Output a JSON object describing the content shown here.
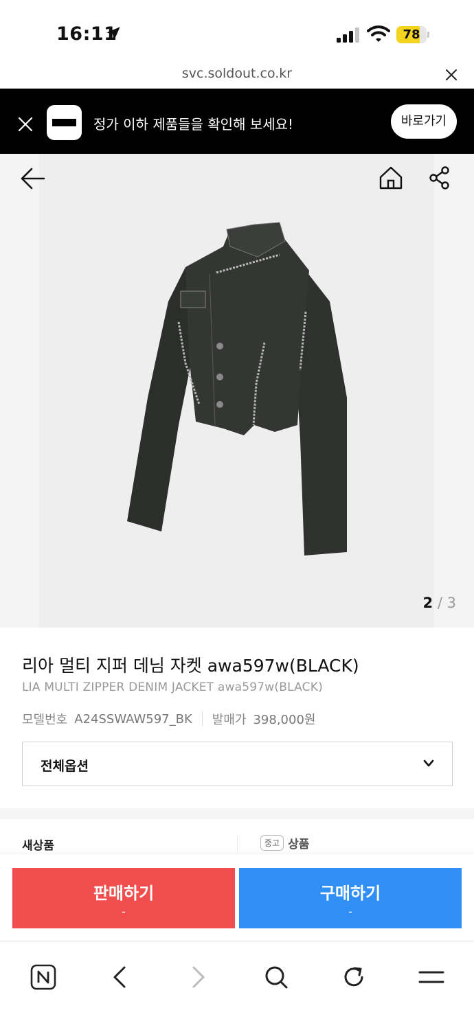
{
  "status_bar": {
    "time": "16:11",
    "battery": "78",
    "battery_level": 0.78
  },
  "url_bar": {
    "url": "svc.soldout.co.kr"
  },
  "banner": {
    "text": "정가 이하 제품들을 확인해 보세요!",
    "button_label": "바로가기"
  },
  "gallery": {
    "current": "2",
    "separator": "/",
    "total": "3"
  },
  "product": {
    "title": "리아 멀티 지퍼 데님 자켓 awa597w(BLACK)",
    "subtitle": "LIA MULTI ZIPPER DENIM JACKET awa597w(BLACK)",
    "model_label": "모델번호",
    "model_value": "A24SSWAW597_BK",
    "release_label": "발매가",
    "release_value": "398,000원"
  },
  "options": {
    "selected": "전체옵션"
  },
  "condition": {
    "new_label": "새상품",
    "used_badge": "중고",
    "used_label": "상품"
  },
  "actions": {
    "sell_label": "판매하기",
    "sell_price": "-",
    "buy_label": "구매하기",
    "buy_price": "-"
  },
  "icons": [
    "location-arrow-icon",
    "signal-icon",
    "wifi-icon",
    "close-icon",
    "back-arrow-icon",
    "home-icon",
    "share-icon",
    "chevron-down-icon",
    "naver-icon",
    "back-icon",
    "forward-icon",
    "search-icon",
    "refresh-icon",
    "menu-icon"
  ]
}
